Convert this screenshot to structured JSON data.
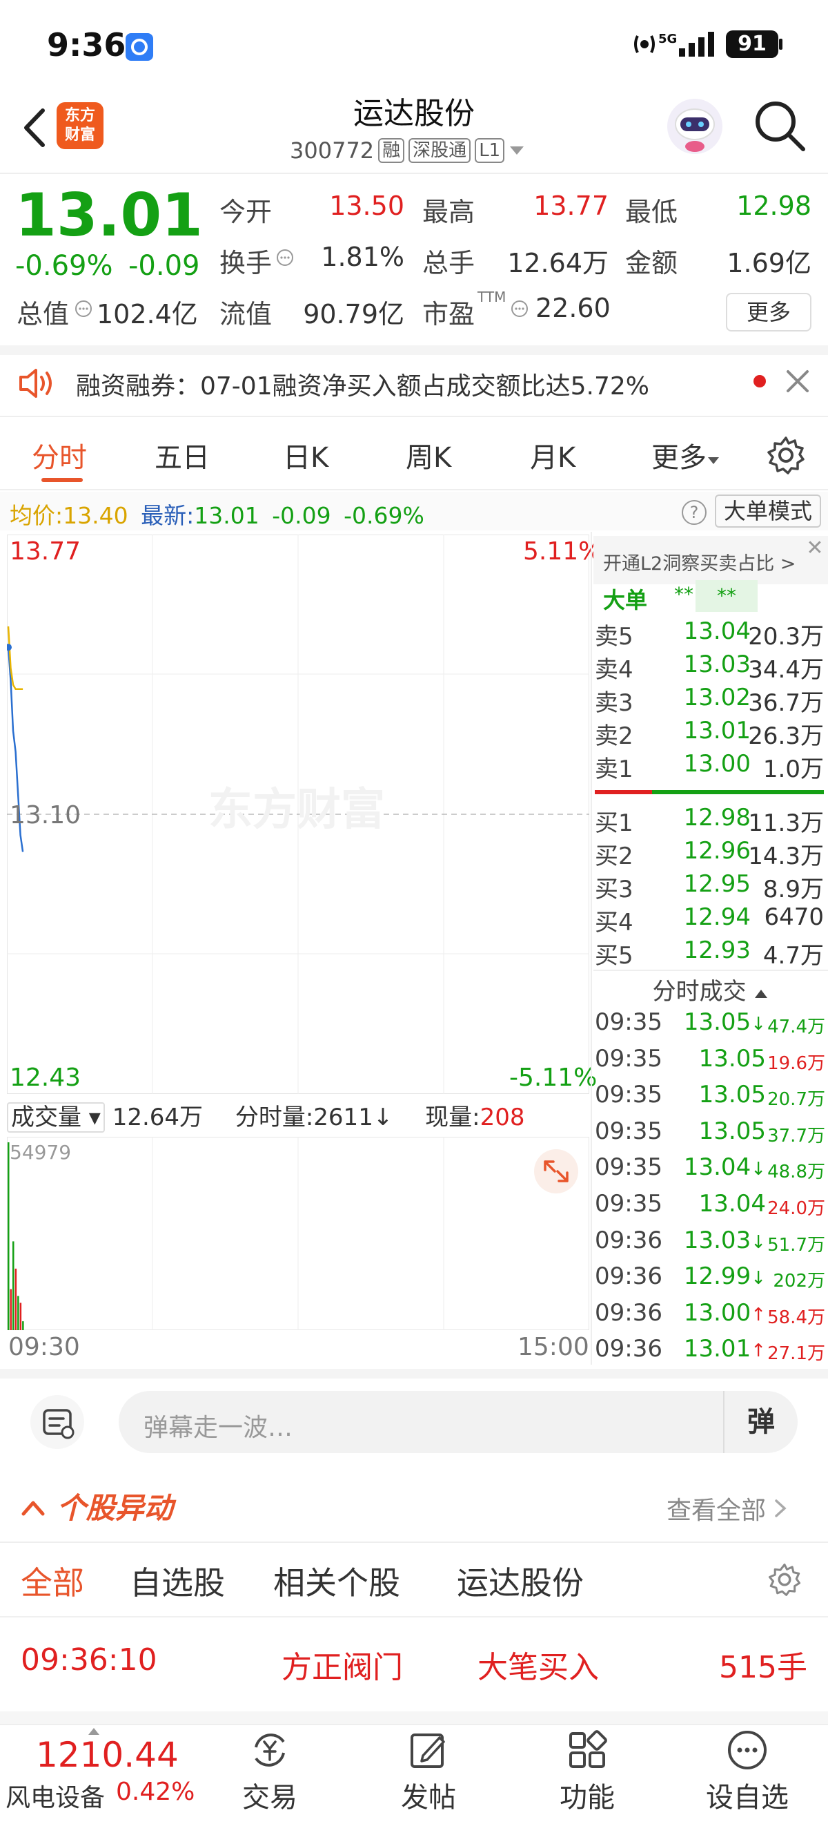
{
  "status_bar": {
    "time": "9:36",
    "battery": "91",
    "network": "5G"
  },
  "header": {
    "logo_text_1": "东方",
    "logo_text_2": "财富",
    "title": "运达股份",
    "code": "300772",
    "tags": [
      "融",
      "深股通",
      "L1"
    ]
  },
  "quote": {
    "last": "13.01",
    "change_pct": "-0.69%",
    "change_abs": "-0.09",
    "fields": [
      {
        "label": "今开",
        "value": "13.50",
        "color": "#e02020"
      },
      {
        "label": "最高",
        "value": "13.77",
        "color": "#e02020"
      },
      {
        "label": "最低",
        "value": "12.98",
        "color": "#14a014"
      },
      {
        "label": "换手",
        "value": "1.81%",
        "color": "#333333"
      },
      {
        "label": "总手",
        "value": "12.64万",
        "color": "#333333"
      },
      {
        "label": "金额",
        "value": "1.69亿",
        "color": "#333333"
      },
      {
        "label": "总值",
        "value": "102.4亿",
        "color": "#333333"
      },
      {
        "label": "流值",
        "value": "90.79亿",
        "color": "#333333"
      },
      {
        "label": "市盈",
        "value": "22.60",
        "color": "#333333"
      }
    ],
    "pe_superscript": "TTM",
    "more_label": "更多"
  },
  "news": {
    "text": "融资融券：07-01融资净买入额占成交额比达5.72%"
  },
  "tabs": [
    "分时",
    "五日",
    "日K",
    "周K",
    "月K",
    "更多"
  ],
  "active_tab": "分时",
  "info_row": {
    "avg_label": "均价:",
    "avg_value": "13.40",
    "latest_label": "最新:",
    "latest_value": "13.01",
    "latest_change": "-0.09",
    "latest_pct": "-0.69%",
    "help": "?",
    "mode_button": "大单模式"
  },
  "chart": {
    "top_price": "13.77",
    "top_pct": "5.11%",
    "mid_price": "13.10",
    "bottom_price": "12.43",
    "bottom_pct": "-5.11%",
    "watermark": "东方财富",
    "vol_label": "成交量",
    "vol_total": "12.64万",
    "vol_period": "分时量:2611↓",
    "vol_now_label": "现量:",
    "vol_now": "208",
    "vol_max": "54979",
    "time_start": "09:30",
    "time_end": "15:00"
  },
  "chart_data": {
    "type": "line",
    "title": "",
    "ylim": [
      12.43,
      13.77
    ],
    "x": [
      "09:30",
      "09:31",
      "09:32",
      "09:33",
      "09:34",
      "09:35",
      "09:36"
    ],
    "series": [
      {
        "values": [
          13.5,
          13.42,
          13.3,
          13.25,
          13.15,
          13.05,
          13.01
        ]
      },
      {
        "values": [
          13.55,
          13.45,
          13.41,
          13.4,
          13.4,
          13.4,
          13.4
        ]
      }
    ],
    "volume": [
      54979,
      12000,
      26000,
      18000,
      10000,
      8000,
      2611
    ]
  },
  "orderbook": {
    "l2_banner": "开通L2洞察买卖占比 >",
    "big_order_label": "大单",
    "big_order_values": [
      "**",
      "**"
    ],
    "asks": [
      {
        "label": "卖5",
        "price": "13.04",
        "vol": "20.3万"
      },
      {
        "label": "卖4",
        "price": "13.03",
        "vol": "34.4万"
      },
      {
        "label": "卖3",
        "price": "13.02",
        "vol": "36.7万"
      },
      {
        "label": "卖2",
        "price": "13.01",
        "vol": "26.3万"
      },
      {
        "label": "卖1",
        "price": "13.00",
        "vol": "1.0万"
      }
    ],
    "bids": [
      {
        "label": "买1",
        "price": "12.98",
        "vol": "11.3万"
      },
      {
        "label": "买2",
        "price": "12.96",
        "vol": "14.3万"
      },
      {
        "label": "买3",
        "price": "12.95",
        "vol": "8.9万"
      },
      {
        "label": "买4",
        "price": "12.94",
        "vol": "6470"
      },
      {
        "label": "买5",
        "price": "12.93",
        "vol": "4.7万"
      }
    ]
  },
  "ticks": {
    "title": "分时成交",
    "rows": [
      {
        "time": "09:35",
        "price": "13.05",
        "arrow": "↓",
        "vol": "47.4万",
        "color": "#14a014"
      },
      {
        "time": "09:35",
        "price": "13.05",
        "arrow": "",
        "vol": "19.6万",
        "color": "#e02020"
      },
      {
        "time": "09:35",
        "price": "13.05",
        "arrow": "",
        "vol": "20.7万",
        "color": "#14a014"
      },
      {
        "time": "09:35",
        "price": "13.05",
        "arrow": "",
        "vol": "37.7万",
        "color": "#14a014"
      },
      {
        "time": "09:35",
        "price": "13.04",
        "arrow": "↓",
        "vol": "48.8万",
        "color": "#14a014"
      },
      {
        "time": "09:35",
        "price": "13.04",
        "arrow": "",
        "vol": "24.0万",
        "color": "#e02020"
      },
      {
        "time": "09:36",
        "price": "13.03",
        "arrow": "↓",
        "vol": "51.7万",
        "color": "#14a014"
      },
      {
        "time": "09:36",
        "price": "12.99",
        "arrow": "↓",
        "vol": "202万",
        "color": "#14a014"
      },
      {
        "time": "09:36",
        "price": "13.00",
        "arrow": "↑",
        "vol": "58.4万",
        "color": "#e02020"
      },
      {
        "time": "09:36",
        "price": "13.01",
        "arrow": "↑",
        "vol": "27.1万",
        "color": "#e02020"
      }
    ]
  },
  "barrage": {
    "placeholder": "弹幕走一波…",
    "send": "弹"
  },
  "abnormal": {
    "title": "个股异动",
    "view_all": "查看全部",
    "tabs": [
      "全部",
      "自选股",
      "相关个股",
      "运达股份"
    ],
    "row": {
      "time": "09:36:10",
      "stock": "方正阀门",
      "type": "大笔买入",
      "amount": "515手"
    }
  },
  "bottom_nav": {
    "index_value": "1210.44",
    "index_name": "风电设备",
    "index_pct": "0.42%",
    "items": [
      "交易",
      "发帖",
      "功能",
      "设自选"
    ]
  },
  "colors": {
    "up": "#e02020",
    "down": "#14a014",
    "accent": "#e8552b"
  }
}
